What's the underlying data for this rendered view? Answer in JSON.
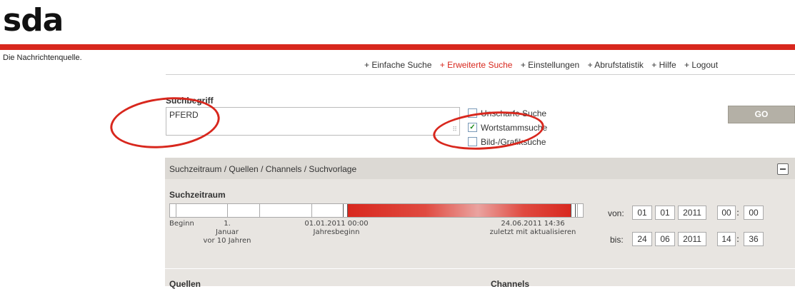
{
  "brand": {
    "logo": "sda",
    "tagline": "Die Nachrichtenquelle.",
    "accent": "#d8271d"
  },
  "nav": {
    "items": [
      {
        "label": "+ Einfache Suche",
        "active": false
      },
      {
        "label": "+ Erweiterte Suche",
        "active": true
      },
      {
        "label": "+ Einstellungen",
        "active": false
      },
      {
        "label": "+ Abrufstatistik",
        "active": false
      },
      {
        "label": "+ Hilfe",
        "active": false
      },
      {
        "label": "+ Logout",
        "active": false
      }
    ]
  },
  "search": {
    "label": "Suchbegriff",
    "value": "PFERD",
    "go_label": "GO",
    "options": [
      {
        "label": "Unscharfe Suche",
        "checked": false
      },
      {
        "label": "Wortstammsuche",
        "checked": true
      },
      {
        "label": "Bild-/Grafiksuche",
        "checked": false
      }
    ]
  },
  "panel": {
    "title": "Suchzeitraum / Quellen / Channels / Suchvorlage",
    "zeitraum_label": "Suchzeitraum",
    "slider": {
      "beginn": "Beginn",
      "januar": "1.\nJanuar\nvor 10 Jahren",
      "jahresbeginn": "01.01.2011 00:00\nJahresbeginn",
      "zuletzt": "24.06.2011 14:36\nzuletzt mit aktualisieren"
    },
    "von": {
      "label": "von:",
      "day": "01",
      "month": "01",
      "year": "2011",
      "hour": "00",
      "minute": "00"
    },
    "bis": {
      "label": "bis:",
      "day": "24",
      "month": "06",
      "year": "2011",
      "hour": "14",
      "minute": "36"
    },
    "quellen_label": "Quellen",
    "channels_label": "Channels"
  }
}
